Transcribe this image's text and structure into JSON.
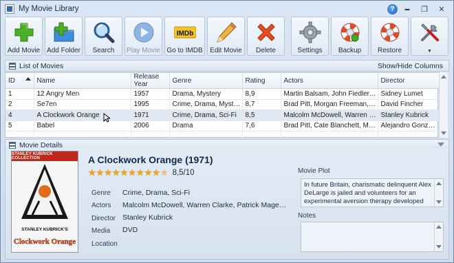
{
  "window": {
    "title": "My Movie Library",
    "controls": {
      "help": "?",
      "minimize": "▬",
      "restore": "❐",
      "close": "✕"
    }
  },
  "toolbar": [
    {
      "id": "add-movie",
      "label": "Add Movie",
      "icon": "plus-icon",
      "disabled": false
    },
    {
      "id": "add-folder",
      "label": "Add Folder",
      "icon": "folder-plus-icon",
      "disabled": false
    },
    {
      "id": "search",
      "label": "Search",
      "icon": "magnifier-icon",
      "disabled": false
    },
    {
      "id": "play-movie",
      "label": "Play Movie",
      "icon": "play-icon",
      "disabled": true
    },
    {
      "id": "go-to-imdb",
      "label": "Go to IMDB",
      "icon": "imdb-icon",
      "disabled": false
    },
    {
      "id": "edit-movie",
      "label": "Edit Movie",
      "icon": "pencil-icon",
      "disabled": false
    },
    {
      "id": "delete",
      "label": "Delete",
      "icon": "red-x-icon",
      "disabled": false
    },
    {
      "id": "settings",
      "label": "Settings",
      "icon": "gear-icon",
      "disabled": false
    },
    {
      "id": "backup",
      "label": "Backup",
      "icon": "lifebuoy-backup-icon",
      "disabled": false
    },
    {
      "id": "restore",
      "label": "Restore",
      "icon": "lifebuoy-restore-icon",
      "disabled": false
    },
    {
      "id": "tools",
      "label": "",
      "icon": "tools-icon",
      "disabled": false,
      "has_dropdown": true
    }
  ],
  "imdb_icon_text": "IMDb",
  "list_panel": {
    "title": "List of Movies",
    "show_hide_columns": "Show/Hide Columns",
    "columns": [
      "ID",
      "Name",
      "Release Year",
      "Genre",
      "Rating",
      "Actors",
      "Director"
    ],
    "sorted_column": "ID",
    "rows": [
      [
        "1",
        "12 Angry Men",
        "1957",
        "Drama, Mystery",
        "8,9",
        "Martin Balsam, John Fiedler, Lee J...",
        "Sidney Lumet"
      ],
      [
        "2",
        "Se7en",
        "1995",
        "Crime, Drama, Mystery, ...",
        "8,7",
        "Brad Pitt, Morgan Freeman, Gwyn...",
        "David Fincher"
      ],
      [
        "4",
        "A Clockwork Orange",
        "1971",
        "Crime, Drama, Sci-Fi",
        "8,5",
        "Malcolm McDowell, Warren Clark...",
        "Stanley Kubrick"
      ],
      [
        "5",
        "Babel",
        "2006",
        "Drama",
        "7,6",
        "Brad Pitt, Cate Blanchett, Moham...",
        "Alejandro Gonzále..."
      ]
    ],
    "selected_row": 2
  },
  "details_panel": {
    "title": "Movie Details",
    "movie_title": "A Clockwork Orange (1971)",
    "rating_stars": 8.5,
    "rating_max": 10,
    "rating_text": "8,5/10",
    "poster": {
      "banner": "STANLEY KUBRICK COLLECTION",
      "credit": "STANLEY KUBRICK'S",
      "title_art": "Clockwork Orange"
    },
    "fields": [
      {
        "label": "Genre",
        "value": "Crime, Drama, Sci-Fi"
      },
      {
        "label": "Actors",
        "value": "Malcolm McDowell, Warren Clarke, Patrick Magee, John Clive"
      },
      {
        "label": "Director",
        "value": "Stanley Kubrick"
      },
      {
        "label": "Media",
        "value": "DVD"
      },
      {
        "label": "Location",
        "value": ""
      }
    ],
    "plot_label": "Movie Plot",
    "plot_text": "In future Britain, charismatic delinquent Alex DeLarge is jailed and volunteers for an experimental aversion therapy developed by the",
    "notes_label": "Notes",
    "notes_text": ""
  }
}
